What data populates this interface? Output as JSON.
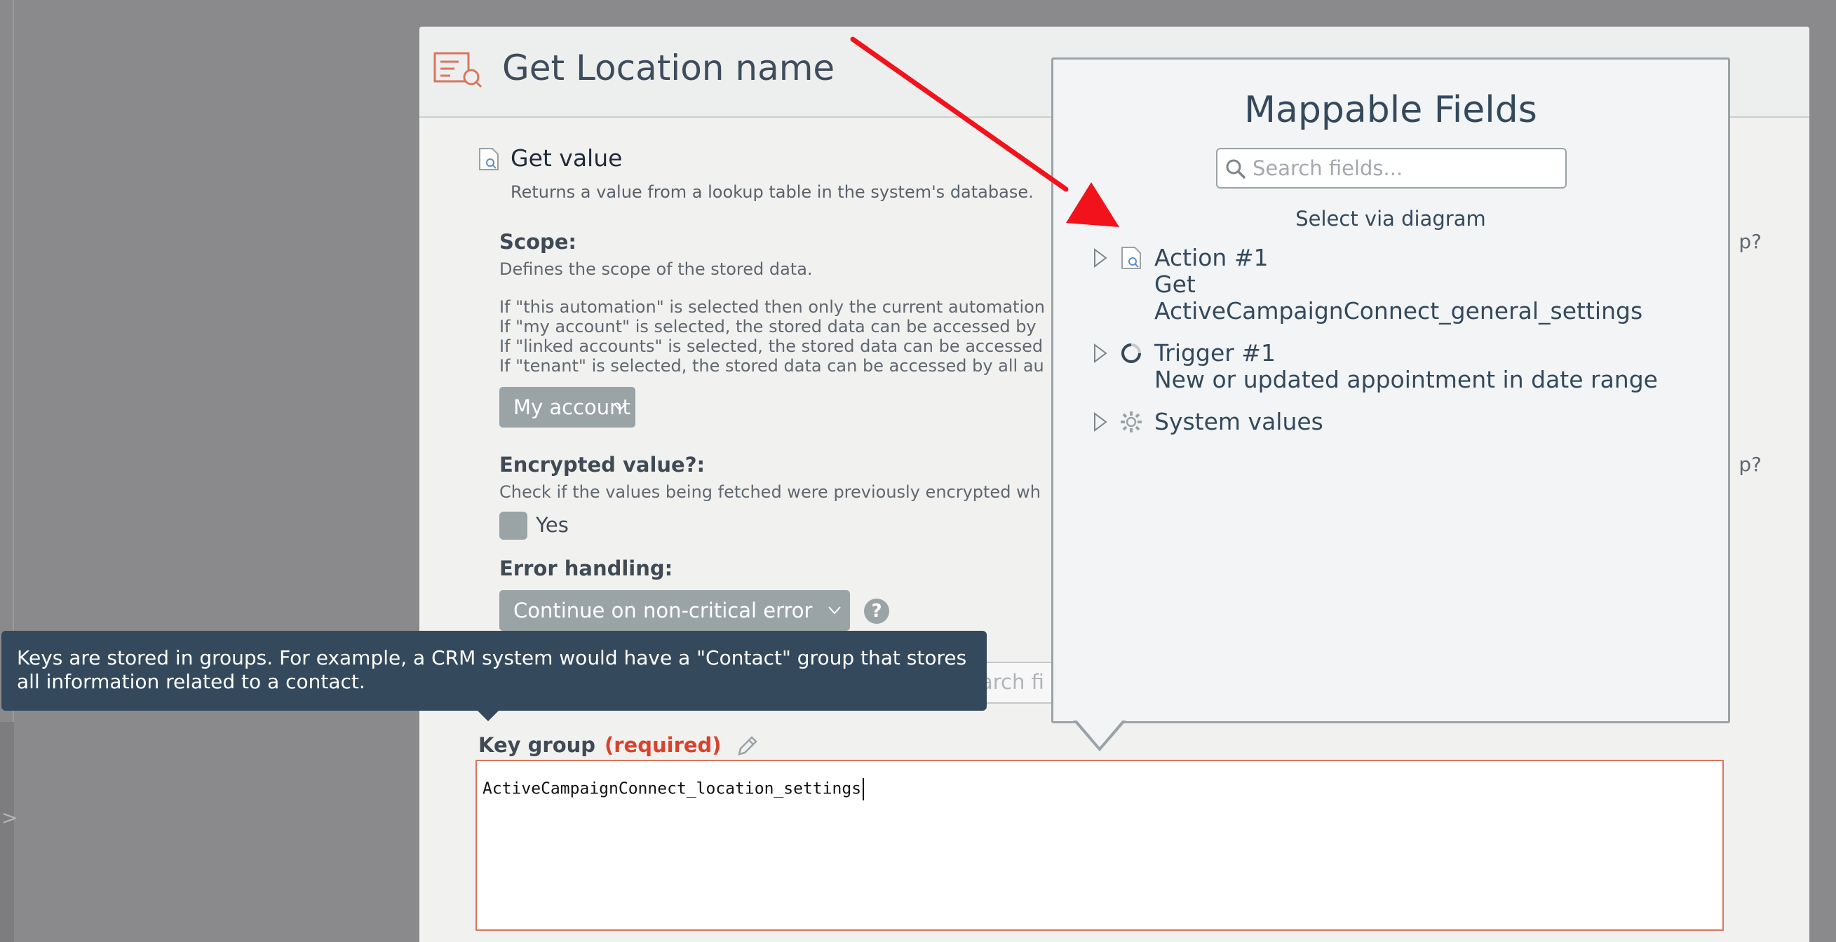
{
  "dialog": {
    "title": "Get Location name"
  },
  "step": {
    "title": "Get value",
    "description": "Returns a value from a lookup table in the system's database."
  },
  "scope": {
    "label": "Scope:",
    "description": "Defines the scope of the stored data.",
    "help_lines": [
      "If \"this automation\" is selected then only the current automation",
      "If \"my account\" is selected, the stored data can be accessed by",
      "If \"linked accounts\" is selected, the stored data can be accessed",
      "If \"tenant\" is selected, the stored data can be accessed by all au"
    ],
    "selected": "My account"
  },
  "encrypted": {
    "label": "Encrypted value?:",
    "description": "Check if the values being fetched were previously encrypted wh",
    "checkbox_label": "Yes"
  },
  "error_handling": {
    "label": "Error handling:",
    "selected": "Continue on non-critical error",
    "help": "?"
  },
  "partial_right": {
    "q1": "p?",
    "q2": "p?"
  },
  "behind_search": {
    "placeholder_fragment": "arch fi"
  },
  "key_group": {
    "label": "Key group",
    "required": "(required)",
    "value": "ActiveCampaignConnect_location_settings"
  },
  "tooltip": {
    "text": "Keys are stored in groups.  For example, a CRM system would have a \"Contact\" group that stores all information related to a contact."
  },
  "popup": {
    "title": "Mappable Fields",
    "search_placeholder": "Search fields...",
    "select_via_diagram": "Select via diagram",
    "items": [
      {
        "icon": "document-search-icon",
        "lines": [
          "Action #1",
          "Get",
          "ActiveCampaignConnect_general_settings"
        ]
      },
      {
        "icon": "spinner-icon",
        "lines": [
          "Trigger #1",
          "New or updated appointment in date range"
        ]
      },
      {
        "icon": "gear-icon",
        "lines": [
          "System values"
        ]
      }
    ]
  },
  "colors": {
    "overlay": "#8a8a8c",
    "tooltip_bg": "#34495c",
    "required": "#d9432b",
    "arrow": "#f2121c"
  }
}
